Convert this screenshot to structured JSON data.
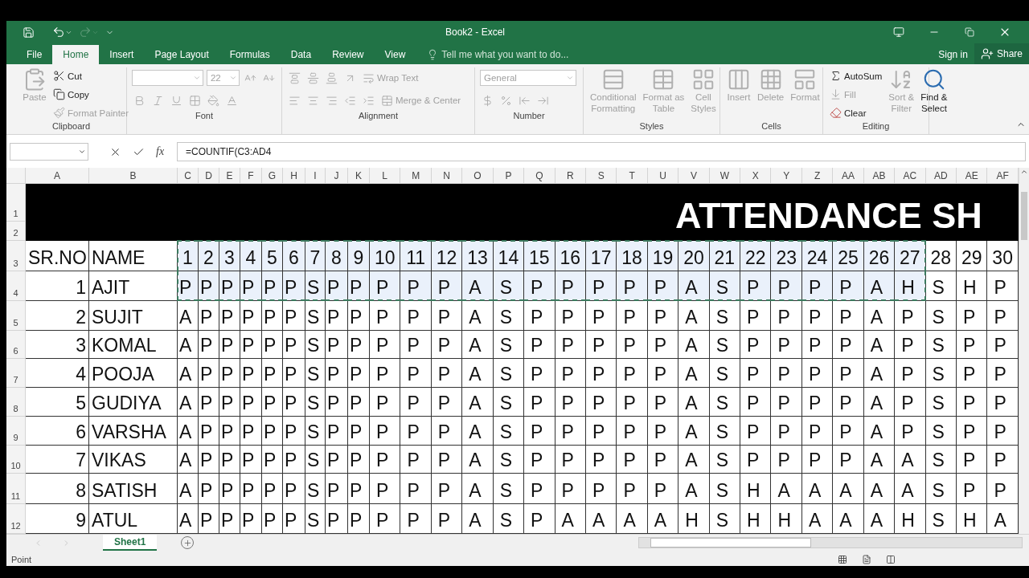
{
  "title_bar": {
    "title": "Book2 - Excel",
    "redo_disabled": true
  },
  "ribbon_tabs": [
    {
      "label": "File",
      "selected": false
    },
    {
      "label": "Home",
      "selected": true
    },
    {
      "label": "Insert",
      "selected": false
    },
    {
      "label": "Page Layout",
      "selected": false
    },
    {
      "label": "Formulas",
      "selected": false
    },
    {
      "label": "Data",
      "selected": false
    },
    {
      "label": "Review",
      "selected": false
    },
    {
      "label": "View",
      "selected": false
    }
  ],
  "tell_me": {
    "placeholder": "Tell me what you want to do..."
  },
  "account": {
    "sign_in": "Sign in",
    "share": "Share"
  },
  "ribbon_groups": [
    {
      "kind": "clipboard",
      "label": "Clipboard",
      "commands": [
        {
          "label": "Paste",
          "disabled": true
        },
        {
          "label": "Cut",
          "disabled": false
        },
        {
          "label": "Copy",
          "disabled": false
        },
        {
          "label": "Format Painter",
          "disabled": true
        }
      ]
    },
    {
      "kind": "font",
      "label": "Font",
      "disabled": true,
      "size_value": "22"
    },
    {
      "kind": "alignment",
      "label": "Alignment",
      "disabled": true,
      "commands": [
        {
          "label": "Wrap Text",
          "disabled": true
        },
        {
          "label": "Merge & Center",
          "disabled": true
        }
      ]
    },
    {
      "kind": "number",
      "label": "Number",
      "disabled": true,
      "format_value": "General"
    },
    {
      "kind": "styles",
      "label": "Styles",
      "commands": [
        {
          "lines": [
            "Conditional",
            "Formatting"
          ],
          "disabled": true
        },
        {
          "lines": [
            "Format as",
            "Table"
          ],
          "disabled": true
        },
        {
          "lines": [
            "Cell",
            "Styles"
          ],
          "disabled": true
        }
      ]
    },
    {
      "kind": "cells",
      "label": "Cells",
      "commands": [
        {
          "label": "Insert",
          "disabled": true
        },
        {
          "label": "Delete",
          "disabled": true
        },
        {
          "label": "Format",
          "disabled": true
        }
      ]
    },
    {
      "kind": "editing",
      "label": "Editing",
      "commands": [
        {
          "label": "AutoSum",
          "disabled": false
        },
        {
          "label": "Fill",
          "disabled": true
        },
        {
          "label": "Clear",
          "disabled": false
        },
        {
          "lines": [
            "Sort &",
            "Filter"
          ],
          "disabled": true
        },
        {
          "lines": [
            "Find &",
            "Select"
          ],
          "disabled": false
        }
      ]
    }
  ],
  "formula_bar": {
    "function_label": "fx",
    "formula": "=COUNTIF(C3:AD4"
  },
  "sheet": {
    "title": "ATTENDANCE SH",
    "title_rows": [
      "1",
      "2"
    ],
    "columns": [
      {
        "letter": "A"
      },
      {
        "letter": "B"
      },
      {
        "letter": "C",
        "in_range": true
      },
      {
        "letter": "D",
        "in_range": true
      },
      {
        "letter": "E",
        "in_range": true
      },
      {
        "letter": "F",
        "in_range": true
      },
      {
        "letter": "G",
        "in_range": true
      },
      {
        "letter": "H",
        "in_range": true
      },
      {
        "letter": "I",
        "in_range": true
      },
      {
        "letter": "J",
        "in_range": true
      },
      {
        "letter": "K",
        "in_range": true
      },
      {
        "letter": "L",
        "in_range": true
      },
      {
        "letter": "M",
        "in_range": true
      },
      {
        "letter": "N",
        "in_range": true
      },
      {
        "letter": "O",
        "in_range": true
      },
      {
        "letter": "P",
        "in_range": true
      },
      {
        "letter": "Q",
        "in_range": true
      },
      {
        "letter": "R",
        "in_range": true
      },
      {
        "letter": "S",
        "in_range": true
      },
      {
        "letter": "T",
        "in_range": true
      },
      {
        "letter": "U",
        "in_range": true
      },
      {
        "letter": "V",
        "in_range": true
      },
      {
        "letter": "W",
        "in_range": true
      },
      {
        "letter": "X",
        "in_range": true
      },
      {
        "letter": "Y",
        "in_range": true
      },
      {
        "letter": "Z",
        "in_range": true
      },
      {
        "letter": "AA",
        "in_range": true
      },
      {
        "letter": "AB",
        "in_range": true
      },
      {
        "letter": "AC",
        "in_range": true
      },
      {
        "letter": "AD"
      },
      {
        "letter": "AE"
      },
      {
        "letter": "AF"
      }
    ],
    "rows": [
      {
        "header": "3",
        "kind": "heading",
        "in_range": true,
        "sr": "SR.NO",
        "name": "NAME",
        "days": [
          "1",
          "2",
          "3",
          "4",
          "5",
          "6",
          "7",
          "8",
          "9",
          "10",
          "11",
          "12",
          "13",
          "14",
          "15",
          "16",
          "17",
          "18",
          "19",
          "20",
          "21",
          "22",
          "23",
          "24",
          "25",
          "26",
          "27",
          "28",
          "29",
          "30"
        ]
      },
      {
        "header": "4",
        "kind": "student",
        "in_range": true,
        "sr": "1",
        "name": "AJIT",
        "days": [
          "P",
          "P",
          "P",
          "P",
          "P",
          "P",
          "S",
          "P",
          "P",
          "P",
          "P",
          "P",
          "A",
          "S",
          "P",
          "P",
          "P",
          "P",
          "P",
          "A",
          "S",
          "P",
          "P",
          "P",
          "P",
          "A",
          "H",
          "S",
          "H",
          "P"
        ]
      },
      {
        "header": "5",
        "kind": "student",
        "in_range": false,
        "sr": "2",
        "name": "SUJIT",
        "days": [
          "A",
          "P",
          "P",
          "P",
          "P",
          "P",
          "S",
          "P",
          "P",
          "P",
          "P",
          "P",
          "A",
          "S",
          "P",
          "P",
          "P",
          "P",
          "P",
          "A",
          "S",
          "P",
          "P",
          "P",
          "P",
          "A",
          "P",
          "S",
          "P",
          "P"
        ]
      },
      {
        "header": "6",
        "kind": "student",
        "in_range": false,
        "sr": "3",
        "name": "KOMAL",
        "days": [
          "A",
          "P",
          "P",
          "P",
          "P",
          "P",
          "S",
          "P",
          "P",
          "P",
          "P",
          "P",
          "A",
          "S",
          "P",
          "P",
          "P",
          "P",
          "P",
          "A",
          "S",
          "P",
          "P",
          "P",
          "P",
          "A",
          "P",
          "S",
          "P",
          "P"
        ]
      },
      {
        "header": "7",
        "kind": "student",
        "in_range": false,
        "sr": "4",
        "name": "POOJA",
        "days": [
          "A",
          "P",
          "P",
          "P",
          "P",
          "P",
          "S",
          "P",
          "P",
          "P",
          "P",
          "P",
          "A",
          "S",
          "P",
          "P",
          "P",
          "P",
          "P",
          "A",
          "S",
          "P",
          "P",
          "P",
          "P",
          "A",
          "P",
          "S",
          "P",
          "P"
        ]
      },
      {
        "header": "8",
        "kind": "student",
        "in_range": false,
        "sr": "5",
        "name": "GUDIYA",
        "days": [
          "A",
          "P",
          "P",
          "P",
          "P",
          "P",
          "S",
          "P",
          "P",
          "P",
          "P",
          "P",
          "A",
          "S",
          "P",
          "P",
          "P",
          "P",
          "P",
          "A",
          "S",
          "P",
          "P",
          "P",
          "P",
          "A",
          "P",
          "S",
          "P",
          "P"
        ]
      },
      {
        "header": "9",
        "kind": "student",
        "in_range": false,
        "sr": "6",
        "name": "VARSHA",
        "days": [
          "A",
          "P",
          "P",
          "P",
          "P",
          "P",
          "S",
          "P",
          "P",
          "P",
          "P",
          "P",
          "A",
          "S",
          "P",
          "P",
          "P",
          "P",
          "P",
          "A",
          "S",
          "P",
          "P",
          "P",
          "P",
          "A",
          "P",
          "S",
          "P",
          "P"
        ]
      },
      {
        "header": "10",
        "kind": "student",
        "in_range": false,
        "sr": "7",
        "name": "VIKAS",
        "days": [
          "A",
          "P",
          "P",
          "P",
          "P",
          "P",
          "S",
          "P",
          "P",
          "P",
          "P",
          "P",
          "A",
          "S",
          "P",
          "P",
          "P",
          "P",
          "P",
          "A",
          "S",
          "P",
          "P",
          "P",
          "P",
          "A",
          "A",
          "S",
          "P",
          "P"
        ]
      },
      {
        "header": "11",
        "kind": "student",
        "in_range": false,
        "sr": "8",
        "name": "SATISH",
        "days": [
          "A",
          "P",
          "P",
          "P",
          "P",
          "P",
          "S",
          "P",
          "P",
          "P",
          "P",
          "P",
          "A",
          "S",
          "P",
          "P",
          "P",
          "P",
          "P",
          "A",
          "S",
          "H",
          "A",
          "A",
          "A",
          "A",
          "A",
          "S",
          "P",
          "P"
        ]
      },
      {
        "header": "12",
        "kind": "student",
        "in_range": false,
        "sr": "9",
        "name": "ATUL",
        "days": [
          "A",
          "P",
          "P",
          "P",
          "P",
          "P",
          "S",
          "P",
          "P",
          "P",
          "P",
          "P",
          "A",
          "S",
          "P",
          "A",
          "A",
          "A",
          "A",
          "H",
          "S",
          "H",
          "H",
          "A",
          "A",
          "A",
          "H",
          "S",
          "H",
          "A"
        ]
      }
    ]
  },
  "sheet_tabs": [
    {
      "label": "Sheet1",
      "selected": true
    }
  ],
  "status_bar": {
    "mode": "Point"
  }
}
